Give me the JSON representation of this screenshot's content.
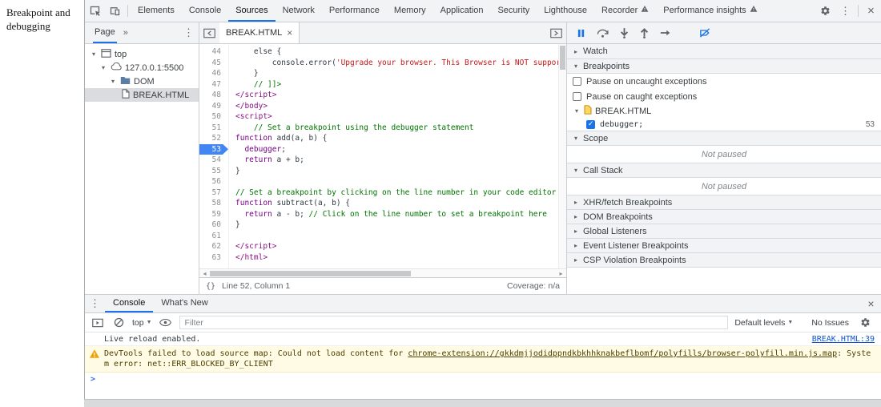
{
  "page_label": "Breakpoint and debugging",
  "toolbar": {
    "tabs": [
      {
        "label": "Elements"
      },
      {
        "label": "Console"
      },
      {
        "label": "Sources"
      },
      {
        "label": "Network"
      },
      {
        "label": "Performance"
      },
      {
        "label": "Memory"
      },
      {
        "label": "Application"
      },
      {
        "label": "Security"
      },
      {
        "label": "Lighthouse"
      },
      {
        "label": "Recorder"
      },
      {
        "label": "Performance insights"
      }
    ]
  },
  "navigator": {
    "header_tab": "Page",
    "more_symbol": "»",
    "tree": [
      {
        "label": "top"
      },
      {
        "label": "127.0.0.1:5500"
      },
      {
        "label": "DOM"
      },
      {
        "label": "BREAK.HTML"
      }
    ]
  },
  "editor": {
    "tab_label": "BREAK.HTML",
    "status": {
      "braces": "{}",
      "line_col": "Line 52, Column 1",
      "coverage": "Coverage: n/a"
    },
    "lines": [
      {
        "n": 44,
        "s": [
          {
            "c": "pln",
            "t": "    else {"
          }
        ]
      },
      {
        "n": 45,
        "s": [
          {
            "c": "pln",
            "t": "        console.error("
          },
          {
            "c": "str",
            "t": "'Upgrade your browser. This Browser is NOT supported Web"
          }
        ]
      },
      {
        "n": 46,
        "s": [
          {
            "c": "pln",
            "t": "    }"
          }
        ]
      },
      {
        "n": 47,
        "s": [
          {
            "c": "com",
            "t": "    // ]]>"
          }
        ]
      },
      {
        "n": 48,
        "s": [
          {
            "c": "tag",
            "t": "</script>"
          }
        ]
      },
      {
        "n": 49,
        "s": [
          {
            "c": "tag",
            "t": "</body>"
          }
        ]
      },
      {
        "n": 50,
        "s": [
          {
            "c": "tag",
            "t": "<script>"
          }
        ]
      },
      {
        "n": 51,
        "s": [
          {
            "c": "com",
            "t": "    // Set a breakpoint using the debugger statement"
          }
        ]
      },
      {
        "n": 52,
        "s": [
          {
            "c": "kwd",
            "t": "function"
          },
          {
            "c": "pln",
            "t": " add(a, b) {"
          }
        ]
      },
      {
        "n": 53,
        "bp": true,
        "s": [
          {
            "c": "pln",
            "t": "  "
          },
          {
            "c": "kwd",
            "t": "debugger"
          },
          {
            "c": "pln",
            "t": ";"
          }
        ]
      },
      {
        "n": 54,
        "s": [
          {
            "c": "pln",
            "t": "  "
          },
          {
            "c": "kwd",
            "t": "return"
          },
          {
            "c": "pln",
            "t": " a + b;"
          }
        ]
      },
      {
        "n": 55,
        "s": [
          {
            "c": "pln",
            "t": "}"
          }
        ]
      },
      {
        "n": 56,
        "s": []
      },
      {
        "n": 57,
        "s": [
          {
            "c": "com",
            "t": "// Set a breakpoint by clicking on the line number in your code editor"
          }
        ]
      },
      {
        "n": 58,
        "s": [
          {
            "c": "kwd",
            "t": "function"
          },
          {
            "c": "pln",
            "t": " subtract(a, b) {"
          }
        ]
      },
      {
        "n": 59,
        "s": [
          {
            "c": "pln",
            "t": "  "
          },
          {
            "c": "kwd",
            "t": "return"
          },
          {
            "c": "pln",
            "t": " a - b; "
          },
          {
            "c": "com",
            "t": "// Click on the line number to set a breakpoint here"
          }
        ]
      },
      {
        "n": 60,
        "s": [
          {
            "c": "pln",
            "t": "}"
          }
        ]
      },
      {
        "n": 61,
        "s": []
      },
      {
        "n": 62,
        "s": [
          {
            "c": "tag",
            "t": "</script>"
          }
        ]
      },
      {
        "n": 63,
        "s": [
          {
            "c": "tag",
            "t": "</html>"
          }
        ]
      }
    ]
  },
  "debugger": {
    "watch": "Watch",
    "breakpoints": {
      "label": "Breakpoints",
      "pause_uncaught": "Pause on uncaught exceptions",
      "pause_caught": "Pause on caught exceptions",
      "file": "BREAK.HTML",
      "entry": "debugger;",
      "entry_line": "53"
    },
    "scope": {
      "label": "Scope",
      "status": "Not paused"
    },
    "call_stack": {
      "label": "Call Stack",
      "status": "Not paused"
    },
    "collapsed": [
      "XHR/fetch Breakpoints",
      "DOM Breakpoints",
      "Global Listeners",
      "Event Listener Breakpoints",
      "CSP Violation Breakpoints"
    ]
  },
  "console": {
    "tabs": [
      "Console",
      "What's New"
    ],
    "context": "top",
    "filter_placeholder": "Filter",
    "default_levels": "Default levels",
    "no_issues": "No Issues",
    "info_message": {
      "text": "Live reload enabled.",
      "source": "BREAK.HTML:39"
    },
    "warning_message": {
      "prefix": "DevTools failed to load source map: Could not load content for ",
      "link": "chrome-extension://gkkdmjjodidppndkbkhhknakbeflbomf/polyfills/browser-polyfill.min.js.map",
      "suffix": ": System error: net::ERR_BLOCKED_BY_CLIENT"
    },
    "prompt": ">"
  },
  "colors": {
    "accent": "#1a73e8",
    "breakpoint_badge": "#4285f4",
    "warning_background": "#fffbe5",
    "warning_icon": "#f0a30a",
    "selection": "#dadce0"
  }
}
